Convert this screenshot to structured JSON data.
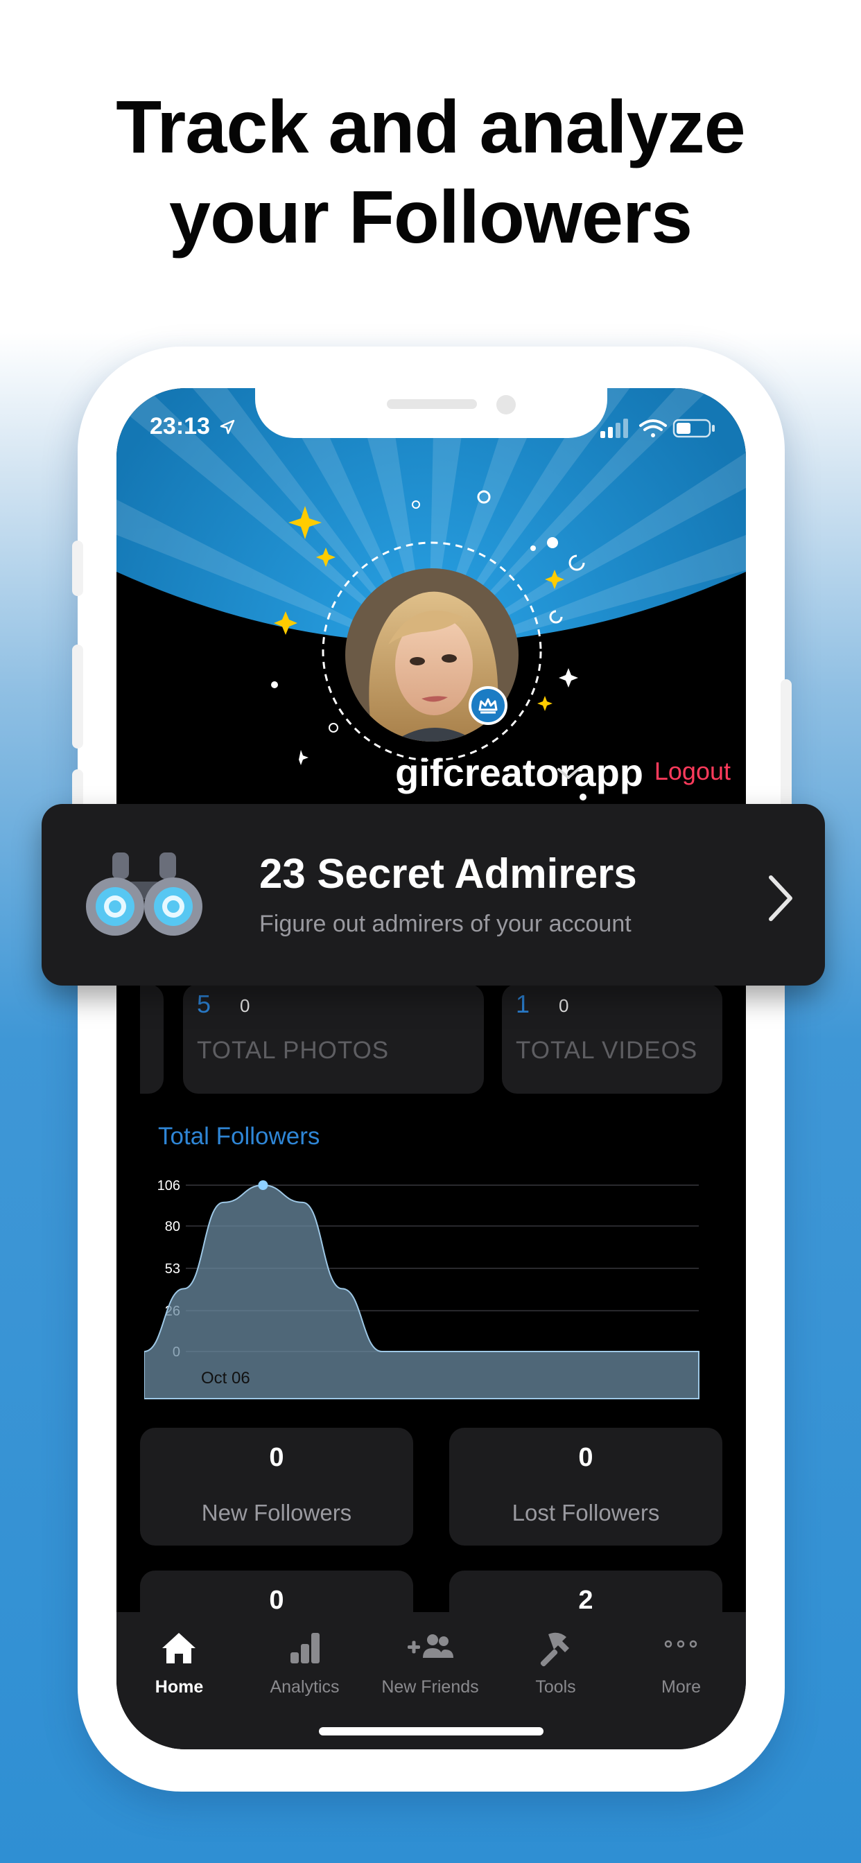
{
  "headline": {
    "line1": "Track and analyze",
    "line2": "your Followers"
  },
  "status_bar": {
    "time": "23:13"
  },
  "profile": {
    "username": "gifcreatorapp",
    "logout_label": "Logout"
  },
  "admirers_card": {
    "title": "23 Secret Admirers",
    "subtitle": "Figure out admirers of your account"
  },
  "top_stats": [
    {
      "value": "5",
      "delta": "0",
      "label": "TOTAL PHOTOS"
    },
    {
      "value": "1",
      "delta": "0",
      "label": "TOTAL VIDEOS"
    }
  ],
  "follower_stats": [
    {
      "value": "0",
      "label": "New Followers"
    },
    {
      "value": "0",
      "label": "Lost Followers"
    },
    {
      "value": "0",
      "label": ""
    },
    {
      "value": "2",
      "label": ""
    }
  ],
  "tabs": [
    {
      "label": "Home",
      "icon": "home-icon",
      "active": true
    },
    {
      "label": "Analytics",
      "icon": "analytics-icon",
      "active": false
    },
    {
      "label": "New Friends",
      "icon": "new-friends-icon",
      "active": false
    },
    {
      "label": "Tools",
      "icon": "tools-icon",
      "active": false
    },
    {
      "label": "More",
      "icon": "more-icon",
      "active": false
    }
  ],
  "colors": {
    "accent": "#2f86d6",
    "logout": "#ff3b5c",
    "card_bg": "#1c1c1e",
    "banner_blue": "#1f8fd0"
  },
  "chart_data": {
    "type": "area",
    "title": "Total Followers",
    "y_ticks": [
      "106",
      "80",
      "53",
      "26",
      "0"
    ],
    "ylim": [
      0,
      106
    ],
    "x_label_visible": "Oct 06",
    "x": [
      "Oct 06"
    ],
    "series": [
      {
        "values": [
          0,
          40,
          95,
          106,
          95,
          40,
          0,
          0,
          0,
          0,
          0,
          0,
          0,
          0,
          0
        ]
      }
    ],
    "grid": true
  }
}
